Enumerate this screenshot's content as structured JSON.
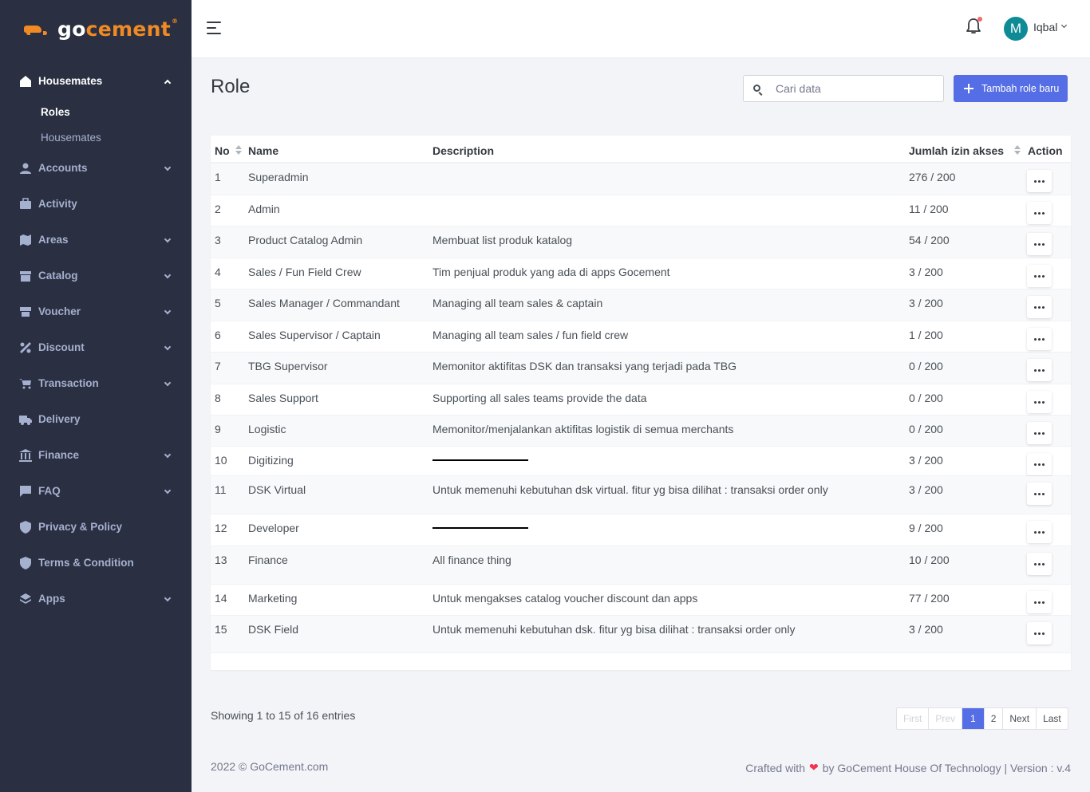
{
  "brand": {
    "go": "go",
    "cement": "cement",
    "reg": "®"
  },
  "sidebar": {
    "housemates": {
      "label": "Housemates",
      "icon": "home-icon",
      "subitems": [
        {
          "label": "Roles",
          "active": true
        },
        {
          "label": "Housemates",
          "active": false
        }
      ]
    },
    "items": [
      {
        "label": "Accounts",
        "icon": "user-icon",
        "has_chevron": true
      },
      {
        "label": "Activity",
        "icon": "briefcase-icon",
        "has_chevron": false
      },
      {
        "label": "Areas",
        "icon": "map-icon",
        "has_chevron": true
      },
      {
        "label": "Catalog",
        "icon": "archive-icon",
        "has_chevron": true
      },
      {
        "label": "Voucher",
        "icon": "ticket-icon",
        "has_chevron": true
      },
      {
        "label": "Discount",
        "icon": "percent-icon",
        "has_chevron": true
      },
      {
        "label": "Transaction",
        "icon": "cart-icon",
        "has_chevron": true
      },
      {
        "label": "Delivery",
        "icon": "truck-icon",
        "has_chevron": false
      },
      {
        "label": "Finance",
        "icon": "bank-icon",
        "has_chevron": true
      },
      {
        "label": "FAQ",
        "icon": "chat-icon",
        "has_chevron": true
      },
      {
        "label": "Privacy & Policy",
        "icon": "shield-icon",
        "has_chevron": false
      },
      {
        "label": "Terms & Condition",
        "icon": "shield-icon",
        "has_chevron": false
      },
      {
        "label": "Apps",
        "icon": "layers-icon",
        "has_chevron": true
      }
    ]
  },
  "header": {
    "user_initial": "M",
    "username": "Iqbal"
  },
  "page": {
    "title": "Role",
    "search_placeholder": "Cari data",
    "add_button": "Tambah role baru"
  },
  "table": {
    "headers": {
      "no": "No",
      "name": "Name",
      "description": "Description",
      "jumlah": "Jumlah izin akses",
      "action": "Action"
    },
    "rows": [
      {
        "no": "1",
        "name": "Superadmin",
        "description": "",
        "jumlah": "276 / 200"
      },
      {
        "no": "2",
        "name": "Admin",
        "description": "",
        "jumlah": "11 / 200"
      },
      {
        "no": "3",
        "name": "Product Catalog Admin",
        "description": "Membuat list produk katalog",
        "jumlah": "54 / 200"
      },
      {
        "no": "4",
        "name": "Sales / Fun Field Crew",
        "description": "Tim penjual produk yang ada di apps Gocement",
        "jumlah": "3 / 200"
      },
      {
        "no": "5",
        "name": "Sales Manager / Commandant",
        "description": "Managing all team sales & captain",
        "jumlah": "3 / 200"
      },
      {
        "no": "6",
        "name": "Sales Supervisor / Captain",
        "description": "Managing all team sales / fun field crew",
        "jumlah": "1 / 200"
      },
      {
        "no": "7",
        "name": "TBG Supervisor",
        "description": "Memonitor aktifitas DSK dan transaksi yang terjadi pada TBG",
        "jumlah": "0 / 200"
      },
      {
        "no": "8",
        "name": "Sales Support",
        "description": "Supporting all sales teams provide the data",
        "jumlah": "0 / 200"
      },
      {
        "no": "9",
        "name": "Logistic",
        "description": "Memonitor/menjalankan aktifitas logistik di semua merchants",
        "jumlah": "0 / 200"
      },
      {
        "no": "10",
        "name": "Digitizing",
        "description": "",
        "jumlah": "3 / 200",
        "underline_desc": true
      },
      {
        "no": "11",
        "name": "DSK Virtual",
        "description": "Untuk memenuhi kebutuhan dsk virtual. fitur yg bisa dilihat : transaksi order only",
        "jumlah": "3 / 200"
      },
      {
        "no": "12",
        "name": "Developer",
        "description": "",
        "jumlah": "9 / 200",
        "underline_desc": true
      },
      {
        "no": "13",
        "name": "Finance",
        "description": "All finance thing",
        "jumlah": "10 / 200"
      },
      {
        "no": "14",
        "name": "Marketing",
        "description": "Untuk mengakses catalog voucher discount dan apps",
        "jumlah": "77 / 200"
      },
      {
        "no": "15",
        "name": "DSK Field",
        "description": "Untuk memenuhi kebutuhan dsk. fitur yg bisa dilihat : transaksi order only",
        "jumlah": "3 / 200"
      }
    ]
  },
  "pagination": {
    "info": "Showing 1 to 15 of 16 entries",
    "buttons": [
      {
        "label": "First",
        "state": "disabled"
      },
      {
        "label": "Prev",
        "state": "disabled"
      },
      {
        "label": "1",
        "state": "active"
      },
      {
        "label": "2",
        "state": "normal"
      },
      {
        "label": "Next",
        "state": "normal"
      },
      {
        "label": "Last",
        "state": "normal"
      }
    ]
  },
  "footer": {
    "left": "2022 © GoCement.com",
    "crafted": "Crafted with",
    "heart": "❤",
    "by": "by GoCement House Of Technology | Version : v.4"
  },
  "colors": {
    "sidebar_bg": "#2a3042",
    "accent": "#556ee6",
    "brand_orange": "#f08a24",
    "avatar": "#0f8b96"
  }
}
